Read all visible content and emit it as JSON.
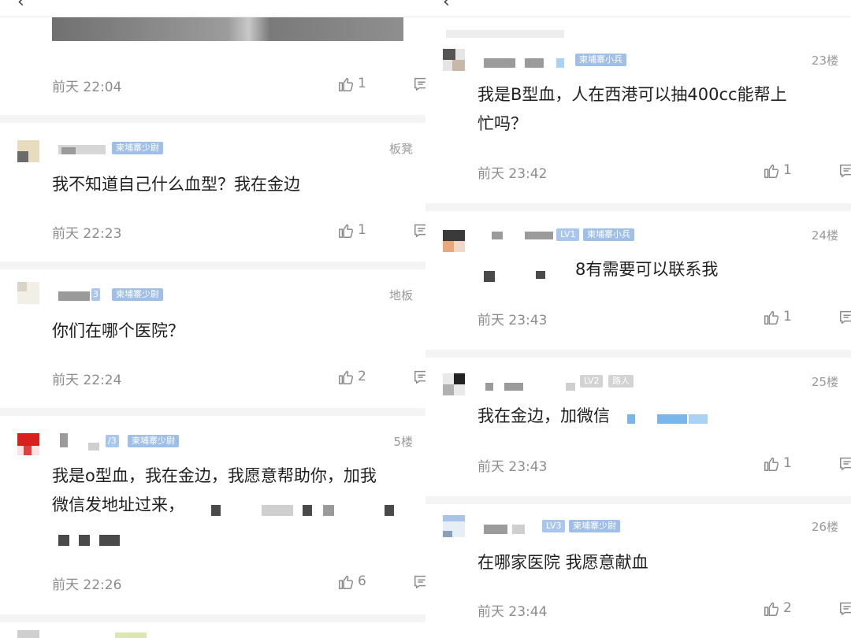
{
  "left_column": {
    "top_meta": {
      "time": "前天 22:04",
      "likes": "1",
      "reply": "回复"
    },
    "comments": [
      {
        "floor": "板凳",
        "badge": "柬埔寨少尉",
        "content": "我不知道自己什么血型？我在金边",
        "time": "前天 22:23",
        "likes": "1",
        "reply": "回复"
      },
      {
        "floor": "地板",
        "badge": "柬埔寨少尉",
        "level_fragment": "3",
        "content": "你们在哪个医院？",
        "time": "前天 22:24",
        "likes": "2",
        "reply": "回复"
      },
      {
        "floor": "5楼",
        "badge": "柬埔寨少尉",
        "level_fragment": "/3",
        "content_line1": "我是o型血，我在金边，我愿意帮助你，加我",
        "content_line2": "微信发地址过来，",
        "time": "前天 22:26",
        "likes": "6",
        "reply": "回复"
      }
    ]
  },
  "right_column": {
    "comments": [
      {
        "floor": "23楼",
        "badge": "柬埔寨小兵",
        "content_line1": "我是B型血，人在西港可以抽400cc能帮上",
        "content_line2": "忙吗？",
        "time": "前天 23:42",
        "likes": "1",
        "reply": "回复"
      },
      {
        "floor": "24楼",
        "level": "LV1",
        "badge": "柬埔寨小兵",
        "content": "8有需要可以联系我",
        "time": "前天 23:43",
        "likes": "1",
        "reply": "回复"
      },
      {
        "floor": "25楼",
        "level": "LV2",
        "badge": "路人",
        "content": "我在金边，加微信",
        "time": "前天 23:43",
        "likes": "1",
        "reply": "回复"
      },
      {
        "floor": "26楼",
        "level": "LV3",
        "badge": "柬埔寨少尉",
        "content": "在哪家医院 我愿意献血",
        "time": "前天 23:44",
        "likes": "2",
        "reply": "回复"
      }
    ]
  },
  "icons": {
    "like": "thumbs-up-icon",
    "reply": "comment-icon",
    "back": "back-arrow-icon"
  }
}
